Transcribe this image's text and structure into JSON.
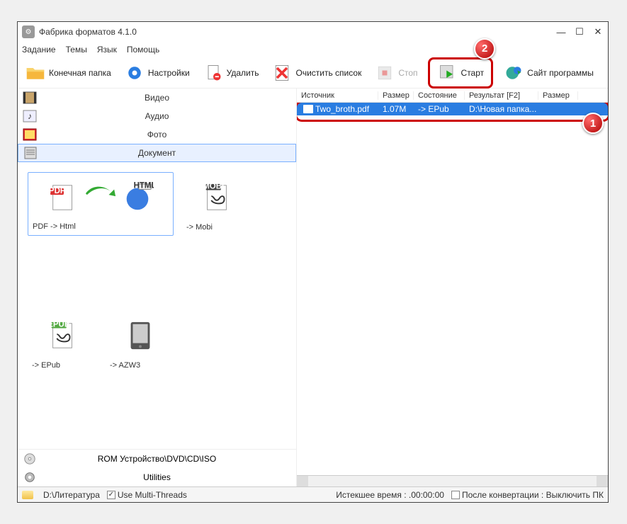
{
  "window": {
    "title": "Фабрика форматов 4.1.0"
  },
  "menu": {
    "task": "Задание",
    "themes": "Темы",
    "lang": "Язык",
    "help": "Помощь"
  },
  "toolbar": {
    "output_folder": "Конечная папка",
    "settings": "Настройки",
    "delete": "Удалить",
    "clear_list": "Очистить список",
    "stop": "Стоп",
    "start": "Старт",
    "site": "Сайт программы"
  },
  "badges": {
    "start": "2",
    "row": "1"
  },
  "categories": {
    "video": "Видео",
    "audio": "Аудио",
    "photo": "Фото",
    "document": "Документ",
    "rom": "ROM Устройство\\DVD\\CD\\ISO",
    "utilities": "Utilities"
  },
  "formats": {
    "pdf_html": "PDF -> Html",
    "mobi": "-> Mobi",
    "epub": "-> EPub",
    "azw3": "-> AZW3"
  },
  "table": {
    "headers": {
      "source": "Источник",
      "size": "Размер",
      "state": "Состояние",
      "result": "Результат [F2]",
      "size2": "Размер"
    },
    "rows": [
      {
        "source": "Two_broth.pdf",
        "size": "1.07M",
        "state": "->  EPub",
        "result": "D:\\Новая папка..."
      }
    ]
  },
  "status": {
    "path": "D:\\Литература",
    "multithreads": "Use Multi-Threads",
    "elapsed": "Истекшее время : .00:00:00",
    "after": "После конвертации : Выключить ПК"
  }
}
